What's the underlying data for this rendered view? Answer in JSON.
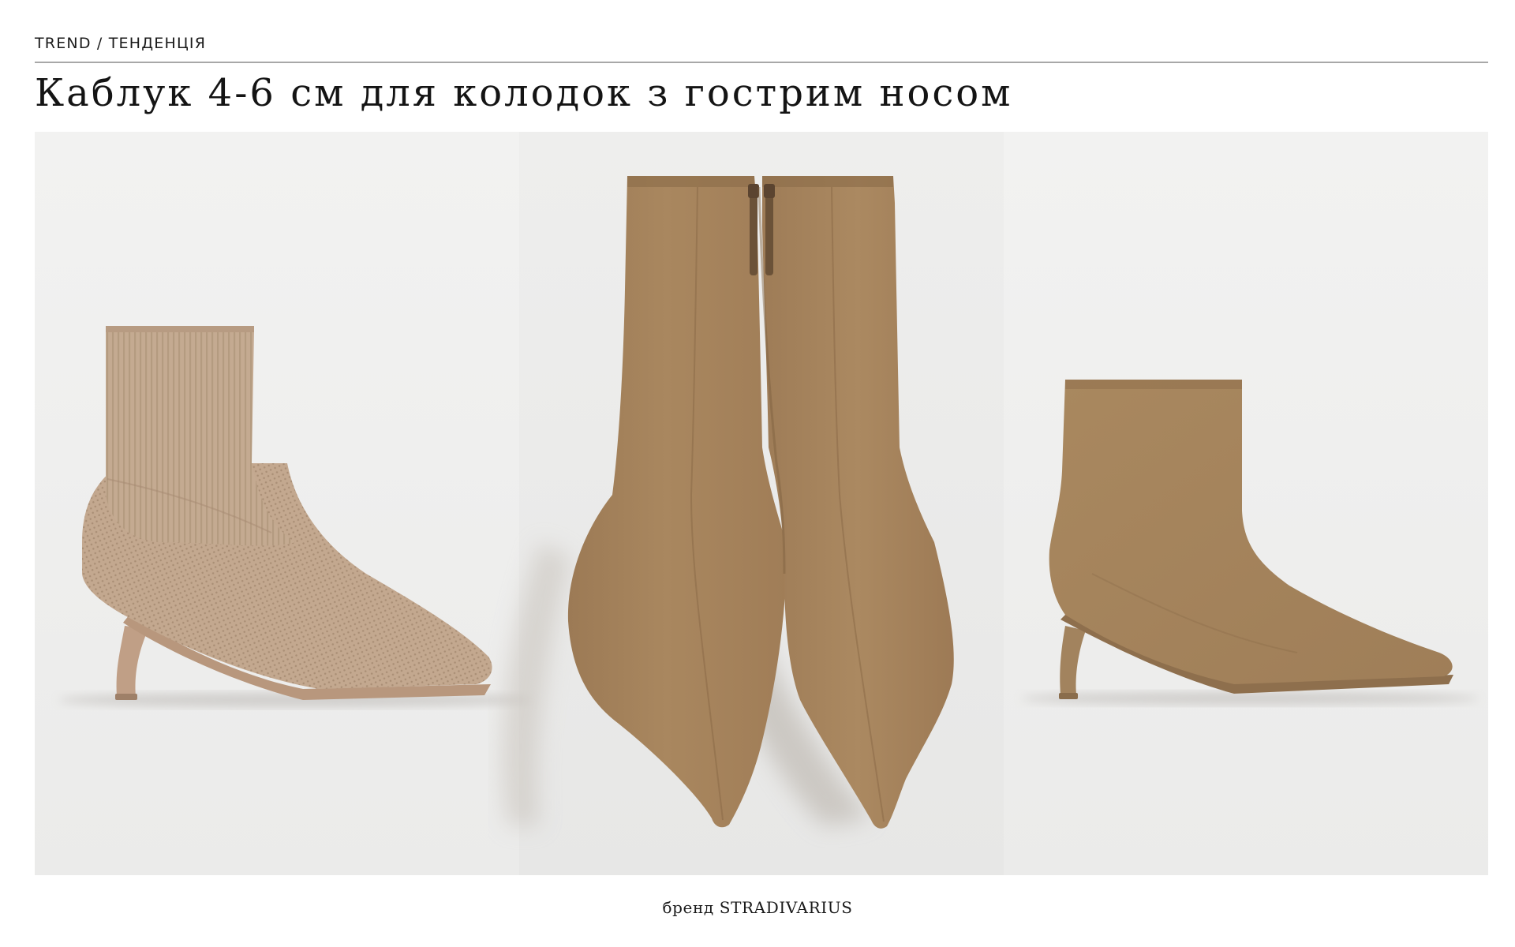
{
  "header": {
    "kicker": "TREND / ТЕНДЕНЦІЯ",
    "title": "Каблук 4-6 см для колодок з гострим носом"
  },
  "photos": [
    {
      "subject": "knit-sock-ankle-boot",
      "color": "#c2a88f"
    },
    {
      "subject": "suede-pointed-ankle-boots-pair-front",
      "color": "#a5835e"
    },
    {
      "subject": "suede-kitten-heel-ankle-boot",
      "color": "#a5845f"
    }
  ],
  "footer": {
    "caption": "бренд STRADIVARIUS"
  }
}
